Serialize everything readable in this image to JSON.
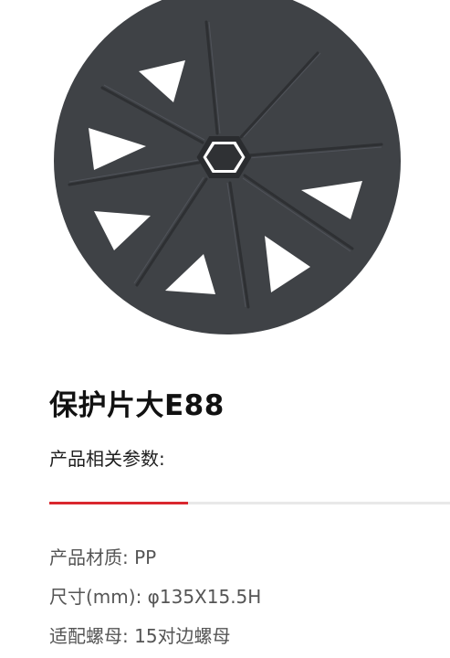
{
  "product": {
    "title": "保护片大E88",
    "section_label": "产品相关参数:",
    "image_color": "#3f4246",
    "accent_color": "#d9272e",
    "specs": [
      {
        "key": "产品材质:",
        "value": "PP"
      },
      {
        "key": "尺寸(mm):",
        "value": "φ135X15.5H"
      },
      {
        "key": "适配螺母:",
        "value": "15对边螺母"
      }
    ]
  }
}
